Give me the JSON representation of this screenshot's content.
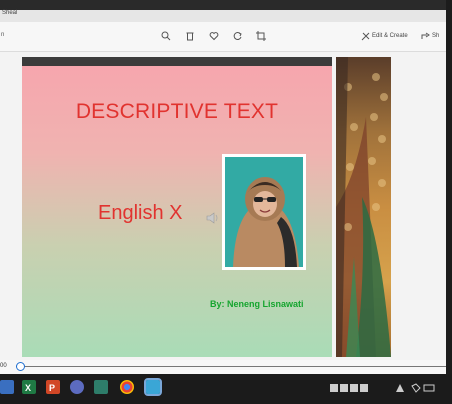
{
  "window": {
    "title": "Sheal",
    "toolbar": {
      "left_text": "n",
      "edit_label": "Edit & Create",
      "share_label": "Sh"
    }
  },
  "slide": {
    "title": "DESCRIPTIVE TEXT",
    "subtitle": "English X",
    "author": "By: Neneng Lisnawati"
  },
  "player": {
    "time": "00",
    "progress": 0.01
  },
  "taskbar": {
    "apps": [
      "file-explorer",
      "excel",
      "powerpoint",
      "chat",
      "media",
      "chrome",
      "photos"
    ],
    "tray": [
      "network-icon",
      "battery-icon",
      "volume-icon",
      "clock-icon"
    ]
  },
  "colors": {
    "title": "#e1332f",
    "author": "#16a52f",
    "accent": "#1f6fd1"
  }
}
